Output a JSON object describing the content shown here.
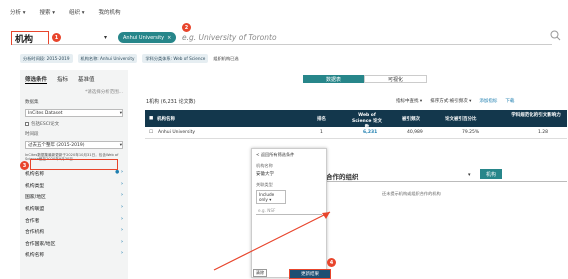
{
  "nav": {
    "items": [
      "分析 ▾",
      "搜索 ▾",
      "组织 ▾",
      "我的机构"
    ]
  },
  "search": {
    "entity_label": "机构",
    "chip_label": "Anhui University",
    "placeholder": "e.g. University of Toronto"
  },
  "filters": [
    "分析时间段: 2015-2019",
    "机构名称: Anhui University",
    "学科分类体系: Web of Science",
    "组织机构已选"
  ],
  "sidebar": {
    "tabs": [
      "筛选条件",
      "指标",
      "基准值"
    ],
    "hint": "*请选择分析范围...",
    "dataset_label": "数据集",
    "dataset_value": "InCites Dataset",
    "esci_label": "包括ESCI论文",
    "time_label": "时间段",
    "time_value": "过去五个整年 (2015-2019)",
    "note": "InCites数据集最新更新于2020年10月31日，包含Web of Science截至2020年9月30日...",
    "items": [
      "机构名称",
      "机构类型",
      "国家/地区",
      "机构联盟",
      "合作者",
      "合作机构",
      "合作国家/地区",
      "机构名称"
    ]
  },
  "view_toggle": {
    "table": "数据表",
    "viz": "可视化"
  },
  "results": {
    "count": "1机构 (6,231 论文数)",
    "actions": [
      "指标中查找 ▾",
      "排序方式:被引频次 ▾",
      "添加指标",
      "下载"
    ],
    "headers": [
      "机构名称",
      "排名",
      "Web of Science 论文数",
      "被引频次",
      "论文被引百分比",
      "学科规范化的引文影响力"
    ],
    "row": {
      "name": "Anhui University",
      "rank": "1",
      "docs": "6,231",
      "citations": "40,989",
      "pct": "79.25%",
      "cnci": "1.28"
    }
  },
  "panel": {
    "back": "< 返回所有筛选条件",
    "entity_label": "机构名称",
    "entity_value": "安徽大学",
    "type_label": "关联类型",
    "type_value": "Include only",
    "input_placeholder": "e.g. NSF",
    "clear": "清除",
    "submit": "更新结果"
  },
  "partner": {
    "label": "合作的组织",
    "button": "机构",
    "message": "还未提示机构或组织合作的机构"
  },
  "callouts": [
    "1",
    "2",
    "3",
    "4"
  ],
  "colors": {
    "accent": "#e8452c",
    "teal": "#27868a",
    "navy": "#13374c"
  }
}
